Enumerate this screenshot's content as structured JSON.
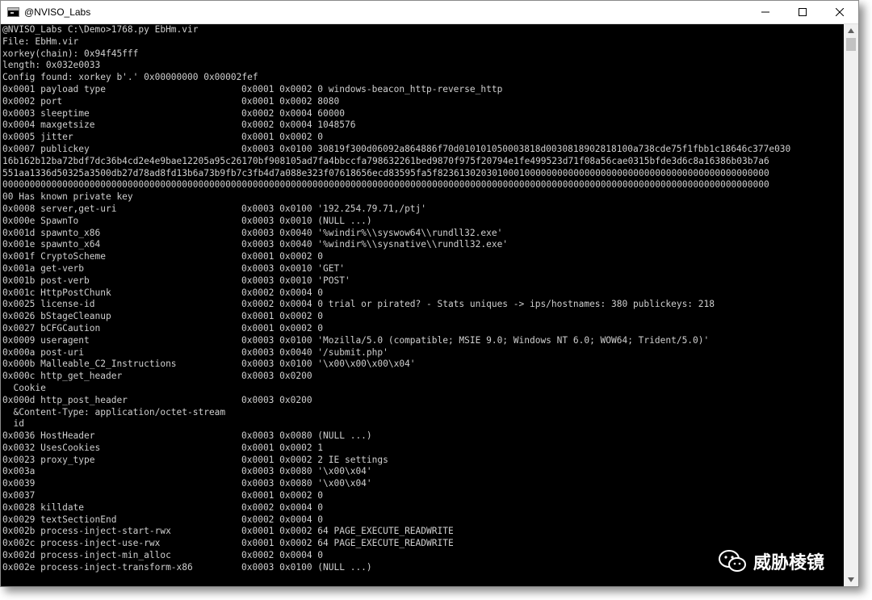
{
  "window": {
    "title": "@NVISO_Labs",
    "minimize_glyph": "—",
    "maximize_glyph": "☐",
    "close_glyph": "✕"
  },
  "terminal": {
    "header_lines": [
      "@NVISO_Labs C:\\Demo>1768.py EbHm.vir",
      "File: EbHm.vir",
      "xorkey(chain): 0x94f45fff",
      "length: 0x032e0033",
      "Config found: xorkey b'.' 0x00000000 0x00002fef"
    ],
    "entries_a": [
      {
        "key": "0x0001 payload type",
        "val": "0x0001 0x0002 0 windows-beacon_http-reverse_http"
      },
      {
        "key": "0x0002 port",
        "val": "0x0001 0x0002 8080"
      },
      {
        "key": "0x0003 sleeptime",
        "val": "0x0002 0x0004 60000"
      },
      {
        "key": "0x0004 maxgetsize",
        "val": "0x0002 0x0004 1048576"
      },
      {
        "key": "0x0005 jitter",
        "val": "0x0001 0x0002 0"
      },
      {
        "key": "0x0007 publickey",
        "val": "0x0003 0x0100 30819f300d06092a864886f70d010101050003818d0030818902818100a738cde75f1fbb1c18646c377e030"
      }
    ],
    "publickey_wrap": [
      "16b162b12ba72bdf7dc36b4cd2e4e9bae12205a95c26170bf908105ad7fa4bbccfa798632261bed9870f975f20794e1fe499523d71f08a56cae0315bfde3d6c8a16386b03b7a6",
      "551aa1336d50325a3500db27d78ad8fd13b6a73b9fb7c3fb4d7a088e323f07618656ecd83595fa5f8236130203010001000000000000000000000000000000000000000000000",
      "000000000000000000000000000000000000000000000000000000000000000000000000000000000000000000000000000000000000000000000000000000000000000000000",
      "00 Has known private key"
    ],
    "entries_b": [
      {
        "key": "0x0008 server,get-uri",
        "val": "0x0003 0x0100 '192.254.79.71,/ptj'"
      },
      {
        "key": "0x000e SpawnTo",
        "val": "0x0003 0x0010 (NULL ...)"
      },
      {
        "key": "0x001d spawnto_x86",
        "val": "0x0003 0x0040 '%windir%\\\\syswow64\\\\rundll32.exe'"
      },
      {
        "key": "0x001e spawnto_x64",
        "val": "0x0003 0x0040 '%windir%\\\\sysnative\\\\rundll32.exe'"
      },
      {
        "key": "0x001f CryptoScheme",
        "val": "0x0001 0x0002 0"
      },
      {
        "key": "0x001a get-verb",
        "val": "0x0003 0x0010 'GET'"
      },
      {
        "key": "0x001b post-verb",
        "val": "0x0003 0x0010 'POST'"
      },
      {
        "key": "0x001c HttpPostChunk",
        "val": "0x0002 0x0004 0"
      },
      {
        "key": "0x0025 license-id",
        "val": "0x0002 0x0004 0 trial or pirated? - Stats uniques -> ips/hostnames: 380 publickeys: 218"
      },
      {
        "key": "0x0026 bStageCleanup",
        "val": "0x0001 0x0002 0"
      },
      {
        "key": "0x0027 bCFGCaution",
        "val": "0x0001 0x0002 0"
      },
      {
        "key": "0x0009 useragent",
        "val": "0x0003 0x0100 'Mozilla/5.0 (compatible; MSIE 9.0; Windows NT 6.0; WOW64; Trident/5.0)'"
      },
      {
        "key": "0x000a post-uri",
        "val": "0x0003 0x0040 '/submit.php'"
      },
      {
        "key": "0x000b Malleable_C2_Instructions",
        "val": "0x0003 0x0100 '\\x00\\x00\\x00\\x04'"
      },
      {
        "key": "0x000c http_get_header",
        "val": "0x0003 0x0200"
      }
    ],
    "get_header_sub": "  Cookie",
    "post_header": {
      "key": "0x000d http_post_header",
      "val": "0x0003 0x0200"
    },
    "post_header_sub": [
      "  &Content-Type: application/octet-stream",
      "  id"
    ],
    "entries_c": [
      {
        "key": "0x0036 HostHeader",
        "val": "0x0003 0x0080 (NULL ...)"
      },
      {
        "key": "0x0032 UsesCookies",
        "val": "0x0001 0x0002 1"
      },
      {
        "key": "0x0023 proxy_type",
        "val": "0x0001 0x0002 2 IE settings"
      },
      {
        "key": "0x003a",
        "val": "0x0003 0x0080 '\\x00\\x04'"
      },
      {
        "key": "0x0039",
        "val": "0x0003 0x0080 '\\x00\\x04'"
      },
      {
        "key": "0x0037",
        "val": "0x0001 0x0002 0"
      },
      {
        "key": "0x0028 killdate",
        "val": "0x0002 0x0004 0"
      },
      {
        "key": "0x0029 textSectionEnd",
        "val": "0x0002 0x0004 0"
      },
      {
        "key": "0x002b process-inject-start-rwx",
        "val": "0x0001 0x0002 64 PAGE_EXECUTE_READWRITE"
      },
      {
        "key": "0x002c process-inject-use-rwx",
        "val": "0x0001 0x0002 64 PAGE_EXECUTE_READWRITE"
      },
      {
        "key": "0x002d process-inject-min_alloc",
        "val": "0x0002 0x0004 0"
      },
      {
        "key": "0x002e process-inject-transform-x86",
        "val": "0x0003 0x0100 (NULL ...)"
      }
    ]
  },
  "watermark": {
    "text": "威胁棱镜",
    "icon": "wechat-icon"
  },
  "colors": {
    "terminal_bg": "#000000",
    "terminal_text": "#cfcfcf",
    "titlebar_bg": "#ffffff"
  }
}
